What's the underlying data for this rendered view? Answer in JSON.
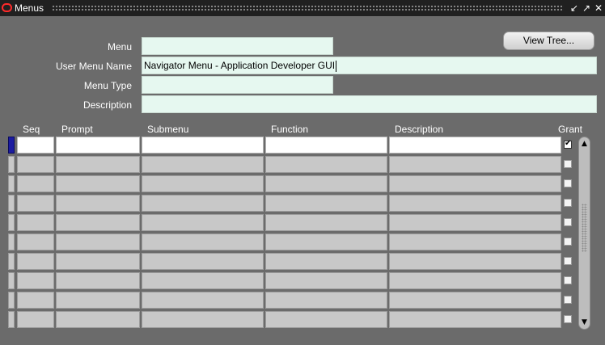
{
  "window": {
    "title": "Menus",
    "controls": [
      "minimize-icon",
      "maximize-icon",
      "close-icon"
    ]
  },
  "header": {
    "menu_label": "Menu",
    "menu_value": "",
    "user_menu_name_label": "User Menu Name",
    "user_menu_name_value": "Navigator Menu - Application Developer GUI",
    "menu_type_label": "Menu Type",
    "menu_type_value": "",
    "description_label": "Description",
    "description_value": "",
    "view_tree_label": "View Tree..."
  },
  "table": {
    "columns": [
      "Seq",
      "Prompt",
      "Submenu",
      "Function",
      "Description",
      "Grant"
    ],
    "rows": [
      {
        "seq": "",
        "prompt": "",
        "submenu": "",
        "function": "",
        "description": "",
        "grant": true
      },
      {
        "seq": "",
        "prompt": "",
        "submenu": "",
        "function": "",
        "description": "",
        "grant": false
      },
      {
        "seq": "",
        "prompt": "",
        "submenu": "",
        "function": "",
        "description": "",
        "grant": false
      },
      {
        "seq": "",
        "prompt": "",
        "submenu": "",
        "function": "",
        "description": "",
        "grant": false
      },
      {
        "seq": "",
        "prompt": "",
        "submenu": "",
        "function": "",
        "description": "",
        "grant": false
      },
      {
        "seq": "",
        "prompt": "",
        "submenu": "",
        "function": "",
        "description": "",
        "grant": false
      },
      {
        "seq": "",
        "prompt": "",
        "submenu": "",
        "function": "",
        "description": "",
        "grant": false
      },
      {
        "seq": "",
        "prompt": "",
        "submenu": "",
        "function": "",
        "description": "",
        "grant": false
      },
      {
        "seq": "",
        "prompt": "",
        "submenu": "",
        "function": "",
        "description": "",
        "grant": false
      },
      {
        "seq": "",
        "prompt": "",
        "submenu": "",
        "function": "",
        "description": "",
        "grant": false
      }
    ]
  },
  "colors": {
    "background": "#6b6b6b",
    "field": "#e6f8f0",
    "titlebar": "#202020",
    "record_indicator_active": "#1c1ca0"
  }
}
